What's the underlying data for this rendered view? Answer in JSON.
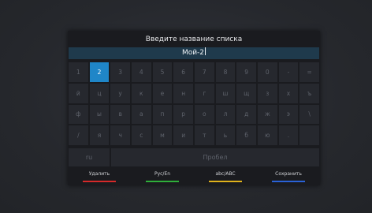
{
  "dialog": {
    "title": "Введите название списка",
    "input_value": "Мой-2"
  },
  "keyboard": {
    "rows": [
      [
        "1",
        "2",
        "3",
        "4",
        "5",
        "6",
        "7",
        "8",
        "9",
        "0",
        "-",
        "="
      ],
      [
        "й",
        "ц",
        "у",
        "к",
        "е",
        "н",
        "г",
        "ш",
        "щ",
        "з",
        "х",
        "ъ"
      ],
      [
        "ф",
        "ы",
        "в",
        "а",
        "п",
        "р",
        "о",
        "л",
        "д",
        "ж",
        "э",
        "\\"
      ],
      [
        "/",
        "я",
        "ч",
        "с",
        "м",
        "и",
        "т",
        "ь",
        "б",
        "ю",
        ".",
        ""
      ]
    ],
    "selected_key": "2",
    "lang_label": "ru",
    "space_label": "Пробел"
  },
  "footer": {
    "actions": [
      {
        "label": "Удалить",
        "color": "#d62a2a"
      },
      {
        "label": "Рус/En",
        "color": "#2fae3a"
      },
      {
        "label": "abc/ABC",
        "color": "#e0b21c"
      },
      {
        "label": "Сохранить",
        "color": "#2a62d6"
      }
    ]
  },
  "colors": {
    "selected_key_bg": "#1f86c8",
    "input_bg": "#1f3a4c"
  }
}
